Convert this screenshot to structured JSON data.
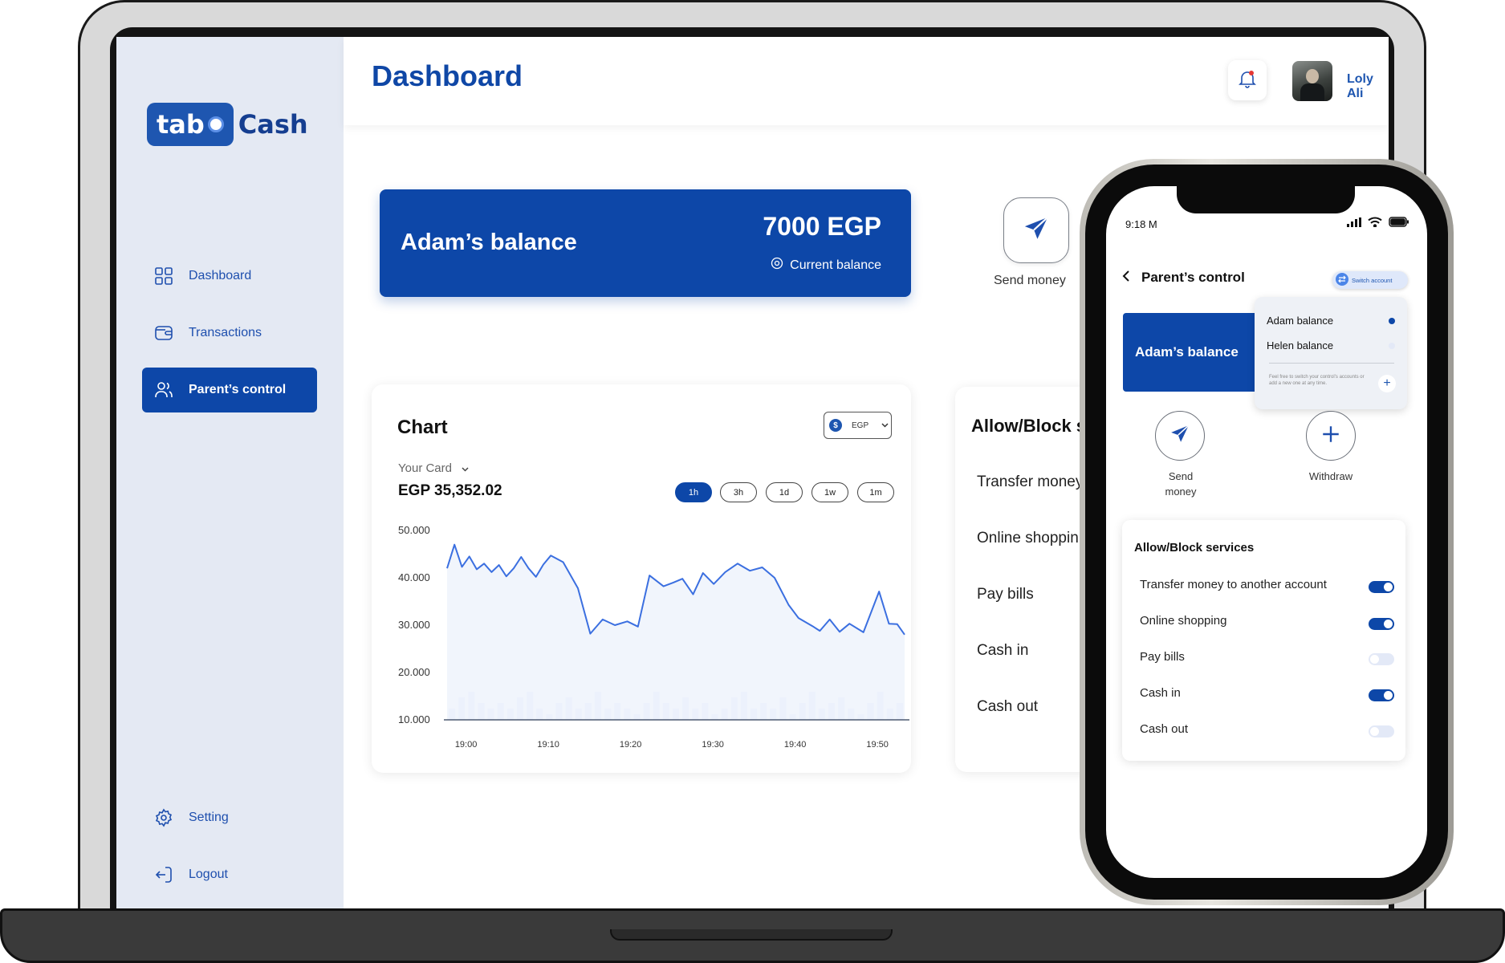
{
  "sidebar": {
    "logo": {
      "part1": "tab",
      "part2": "Cash"
    },
    "items": [
      {
        "label": "Dashboard",
        "icon": "grid-icon"
      },
      {
        "label": "Transactions",
        "icon": "wallet-icon"
      },
      {
        "label": "Parent’s control",
        "icon": "users-icon",
        "active": true
      }
    ],
    "bottom": [
      {
        "label": "Setting",
        "icon": "gear-icon"
      },
      {
        "label": "Logout",
        "icon": "logout-icon"
      }
    ]
  },
  "header": {
    "title": "Dashboard",
    "user_name": "Loly Ali"
  },
  "balance_card": {
    "title": "Adam’s balance",
    "amount": "7000 EGP",
    "subtitle": "Current balance"
  },
  "actions": {
    "send_money": "Send money"
  },
  "chart_card": {
    "title": "Chart",
    "currency": "EGP",
    "card_selector": "Your Card",
    "card_amount": "EGP 35,352.02",
    "ranges": [
      "1h",
      "3h",
      "1d",
      "1w",
      "1m"
    ],
    "active_range": "1h"
  },
  "chart_data": {
    "type": "line",
    "title": "",
    "xlabel": "",
    "ylabel": "",
    "ylim": [
      10000,
      50000
    ],
    "yticks": [
      "50.000",
      "40.000",
      "30.000",
      "20.000",
      "10.000"
    ],
    "ytick_values": [
      50000,
      40000,
      30000,
      20000,
      10000
    ],
    "xticks": [
      "19:00",
      "19:10",
      "19:20",
      "19:30",
      "19:40",
      "19:50"
    ],
    "xtick_values": [
      0,
      10,
      20,
      30,
      40,
      50
    ],
    "xlim": [
      -2.3,
      53.3
    ],
    "grid": false,
    "series": [
      {
        "x": [
          -2.3,
          -1.4,
          -0.5,
          0.4,
          1.3,
          2.2,
          3.1,
          4.0,
          4.9,
          5.8,
          6.7,
          7.6,
          8.5,
          9.4,
          10.3,
          11.8,
          13.6,
          15.1,
          16.6,
          18.1,
          19.6,
          20.9,
          22.3,
          24.0,
          25.2,
          26.3,
          27.6,
          28.8,
          30.1,
          31.5,
          33.0,
          34.5,
          36.0,
          37.5,
          39.2,
          40.4,
          42.1,
          43.0,
          44.2,
          45.4,
          46.6,
          48.3,
          50.2,
          51.4,
          52.4,
          53.3
        ],
        "y": [
          42000,
          47000,
          42300,
          44500,
          41800,
          43000,
          41200,
          42700,
          40300,
          42000,
          44400,
          42000,
          40200,
          42800,
          44700,
          43300,
          37800,
          28200,
          31200,
          30000,
          30800,
          29700,
          40500,
          38200,
          39000,
          39800,
          36500,
          41000,
          38700,
          41200,
          43000,
          41500,
          42200,
          40000,
          34300,
          31500,
          29800,
          28800,
          31200,
          28600,
          30300,
          28500,
          37100,
          30300,
          30200,
          28000
        ]
      }
    ],
    "volume_bars": [
      2,
      4,
      5,
      3,
      2,
      3,
      2,
      4,
      5,
      2,
      1,
      3,
      4,
      2,
      3,
      5,
      2,
      3,
      2,
      1,
      3,
      5,
      3,
      2,
      4,
      2,
      3,
      1,
      2,
      4,
      5,
      2,
      3,
      2,
      4,
      1,
      3,
      5,
      2,
      3,
      4,
      2,
      1,
      3,
      5,
      2,
      3
    ]
  },
  "allow_block_desktop": {
    "title": "Allow/Block s",
    "items": [
      "Transfer money",
      "Online shoppin",
      "Pay bills",
      "Cash in",
      "Cash out"
    ]
  },
  "phone": {
    "time": "9:18 M",
    "header": "Parent’s control",
    "switch_account": "Switch account",
    "balance_title": "Adam’s balance",
    "accounts": [
      {
        "name": "Adam balance",
        "selected": true
      },
      {
        "name": "Helen balance",
        "selected": false
      }
    ],
    "account_hint": "Feel free to switch your control’s accounts or add a new one at any time.",
    "send_money": "Send\nmoney",
    "withdraw": "Withdraw",
    "allow_block": {
      "title": "Allow/Block services",
      "items": [
        {
          "label": "Transfer money to another account",
          "on": true
        },
        {
          "label": "Online shopping",
          "on": true
        },
        {
          "label": "Pay bills",
          "on": false
        },
        {
          "label": "Cash in",
          "on": true
        },
        {
          "label": "Cash out",
          "on": false
        }
      ]
    }
  },
  "colors": {
    "primary": "#0d47a8",
    "sidebar_bg": "#e4e9f3",
    "chart_line": "#3b6fe0",
    "chart_fill": "#eef3fc",
    "volume_bar": "#dbe5fb"
  }
}
